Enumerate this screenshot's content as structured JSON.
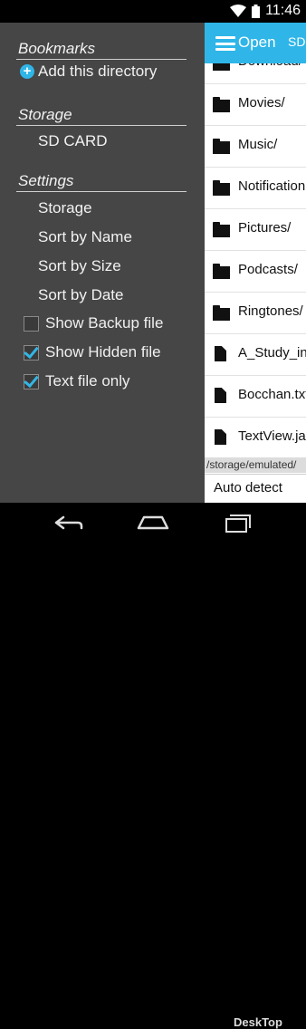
{
  "status": {
    "time": "11:46"
  },
  "drawer": {
    "bookmarks_title": "Bookmarks",
    "add_directory": "Add this directory",
    "storage_title": "Storage",
    "storage_items": [
      "SD CARD"
    ],
    "settings_title": "Settings",
    "settings_items": [
      "Storage",
      "Sort by Name",
      "Sort by Size",
      "Sort by Date"
    ],
    "checkboxes": [
      {
        "label": "Show Backup file",
        "checked": false
      },
      {
        "label": "Show Hidden file",
        "checked": true
      },
      {
        "label": "Text file only",
        "checked": true
      }
    ]
  },
  "actionbar": {
    "title": "Open",
    "path_hint": "SD"
  },
  "files": [
    {
      "name": "Download/",
      "type": "folder"
    },
    {
      "name": "Movies/",
      "type": "folder"
    },
    {
      "name": "Music/",
      "type": "folder"
    },
    {
      "name": "Notification",
      "type": "folder"
    },
    {
      "name": "Pictures/",
      "type": "folder"
    },
    {
      "name": "Podcasts/",
      "type": "folder"
    },
    {
      "name": "Ringtones/",
      "type": "folder"
    },
    {
      "name": "A_Study_in_",
      "type": "file"
    },
    {
      "name": "Bocchan.txt",
      "type": "file"
    },
    {
      "name": "TextView.ja",
      "type": "file"
    }
  ],
  "current_path": "/storage/emulated/",
  "encoding": "Auto detect",
  "watermark": "DeskTop",
  "colors": {
    "accent": "#2fb5e8",
    "drawer_bg": "#464646"
  }
}
